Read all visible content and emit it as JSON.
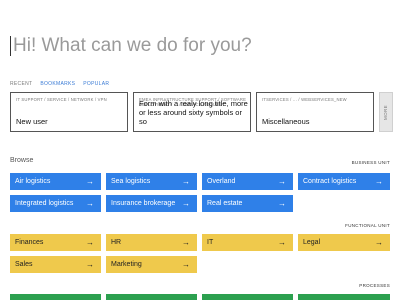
{
  "search": {
    "placeholder": "Hi! What can we do for you?"
  },
  "tabs": [
    {
      "label": "RECENT",
      "active": false
    },
    {
      "label": "BOOKMARKS",
      "active": true
    },
    {
      "label": "POPULAR",
      "active": true
    }
  ],
  "recent_cards": [
    {
      "path": "IT SUPPORT / SERVICE / NETWORK / VPN",
      "title": "New user"
    },
    {
      "path": "EMEA INFRASTRUCTURE SUPPORT / SOFTWARE DEPLOYMENT / ... / SERVICE REQUEST",
      "title": "Form with a realy long title, more or less around sixty symbols or so"
    },
    {
      "path": "ITSERVICES / ... / WEBSERVICES_NEW",
      "title": "Miscellaneous"
    }
  ],
  "more_label": "MORE",
  "browse": {
    "title": "Browse",
    "groups": [
      {
        "unit": "BUSINESS UNIT",
        "color": "#2f80e8",
        "items": [
          "Air logistics",
          "Sea logistics",
          "Overland",
          "Contract logistics",
          "Integrated logistics",
          "Insurance brokerage",
          "Real estate"
        ]
      },
      {
        "unit": "FUNCTIONAL UNIT",
        "color": "#efc94c",
        "items": [
          "Finances",
          "HR",
          "IT",
          "Legal",
          "Sales",
          "Marketing"
        ]
      },
      {
        "unit": "PROCESSES",
        "color": "#2ca04f",
        "items": [
          "",
          "",
          "",
          ""
        ]
      }
    ]
  },
  "icons": {
    "tile_arrow": "arrow-right-icon",
    "arrow_glyph": "→"
  }
}
